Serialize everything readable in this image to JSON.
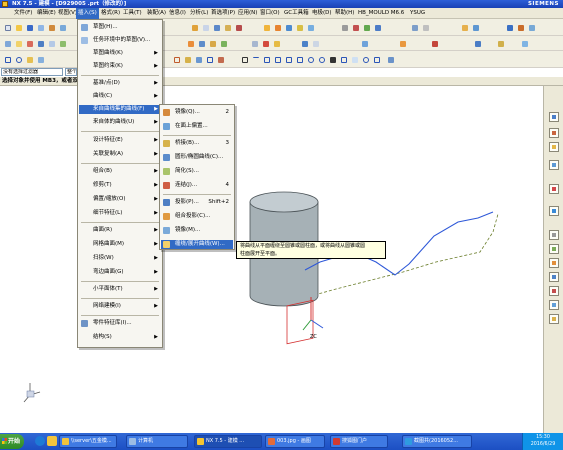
{
  "window": {
    "title": "NX 7.5 - 建模 - [D929005 .prt（修改的）]",
    "brand": "SIEMENS"
  },
  "menubar": {
    "items": [
      "文件(F)",
      "编辑(E)",
      "视图(V)",
      "插入(S)",
      "格式(R)",
      "工具(T)",
      "装配(A)",
      "信息(I)",
      "分析(L)",
      "首选项(P)",
      "应用(N)",
      "窗口(O)",
      "GC工具箱",
      "电极(D)",
      "帮助(H)",
      "HB_MOULD M6.6",
      "YSUG"
    ]
  },
  "filter": {
    "selection_filter": "没有选择过滤器",
    "scope": "整个装配"
  },
  "status": {
    "prompt": "选择对象并使用 MB3，或者双击某一对象"
  },
  "insert_menu": {
    "items": [
      {
        "label": "草图(H)...",
        "arrow": false
      },
      {
        "label": "任务环境中的草图(V)...",
        "arrow": false
      },
      {
        "label": "草图曲线(K)",
        "arrow": true
      },
      {
        "label": "草图约束(K)",
        "arrow": true
      },
      {
        "label": "基准/点(D)",
        "arrow": true
      },
      {
        "label": "曲线(C)",
        "arrow": true
      },
      {
        "label": "来自曲线集的曲线(F)",
        "arrow": true
      },
      {
        "label": "来自体的曲线(U)",
        "arrow": true
      },
      {
        "label": "设计特征(E)",
        "arrow": true
      },
      {
        "label": "关联复制(A)",
        "arrow": true
      },
      {
        "label": "组合(B)",
        "arrow": true
      },
      {
        "label": "修剪(T)",
        "arrow": true
      },
      {
        "label": "偏置/缩放(O)",
        "arrow": true
      },
      {
        "label": "细节特征(L)",
        "arrow": true
      },
      {
        "label": "曲面(R)",
        "arrow": true
      },
      {
        "label": "网格曲面(M)",
        "arrow": true
      },
      {
        "label": "扫掠(W)",
        "arrow": true
      },
      {
        "label": "弯边曲面(G)",
        "arrow": true
      },
      {
        "label": "小平面体(T)",
        "arrow": true
      },
      {
        "label": "网络建模(I)",
        "arrow": true
      },
      {
        "label": "零件特征库(I)...",
        "arrow": false
      },
      {
        "label": "结构(S)",
        "arrow": true
      }
    ]
  },
  "curve_set_menu": {
    "items": [
      {
        "label": "镜像(Q)...",
        "shortcut": "2"
      },
      {
        "label": "在面上偏置...",
        "shortcut": ""
      },
      {
        "label": "桥接(B)...",
        "shortcut": "3"
      },
      {
        "label": "圆形/椭圆曲线(C)...",
        "shortcut": ""
      },
      {
        "label": "简化(S)...",
        "shortcut": ""
      },
      {
        "label": "连结(J)...",
        "shortcut": "4"
      },
      {
        "label": "投影(P)...",
        "shortcut": "Shift+2"
      },
      {
        "label": "组合投影(C)...",
        "shortcut": ""
      },
      {
        "label": "镜像(M)...",
        "shortcut": ""
      },
      {
        "label": "缠绕/展开曲线(W)...",
        "shortcut": ""
      }
    ]
  },
  "tooltip": {
    "line1": "将曲线从平面缠绕至圆锥或圆柱面，或将曲线从圆锥或圆",
    "line2": "柱面展开至平面。"
  },
  "viewport": {
    "csys_label": "ZC"
  },
  "taskbar": {
    "start_label": "开始",
    "tasks": [
      "\\\\server\\五金模...",
      "计算机",
      "NX 7.5 - 建模 ...",
      "003.jpg - 画图",
      "搜狐图门户",
      "截图共(2016052..."
    ],
    "time": "15:30",
    "date": "2016/6/29"
  },
  "colors": {
    "cylinder_fill": "#a6b1b6",
    "curve_blue": "#2e58d8",
    "dashed_curve": "#6a7d2a",
    "highlight": "#316ac5"
  }
}
